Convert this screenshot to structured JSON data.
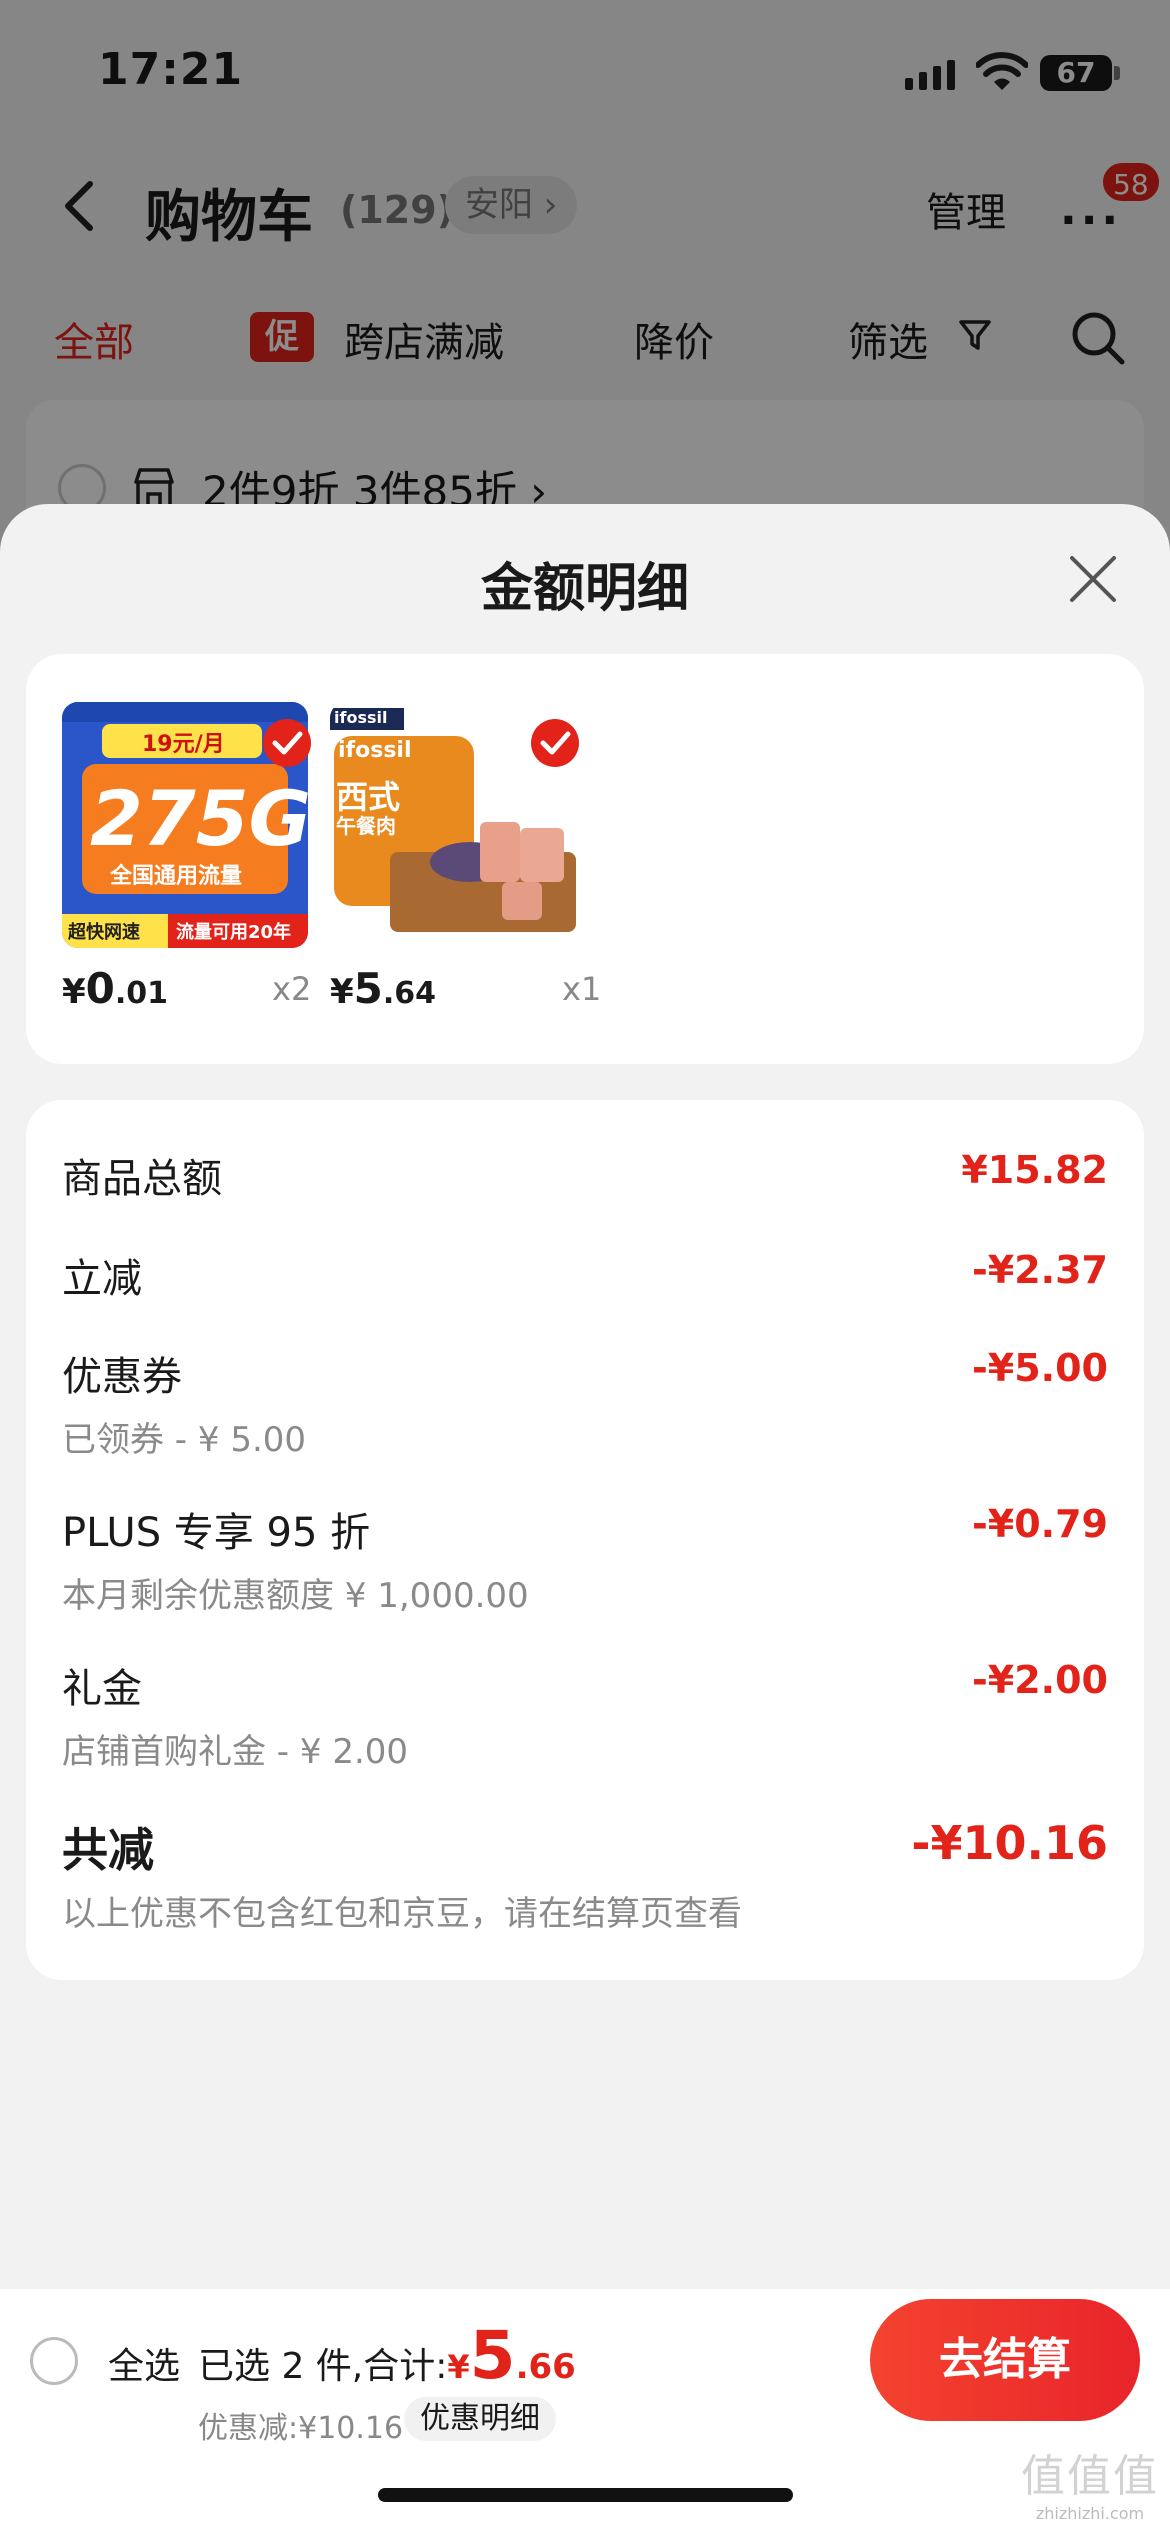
{
  "status_bar": {
    "time": "17:21",
    "battery": "67"
  },
  "nav": {
    "back_icon": "chevron-left-icon",
    "title": "购物车",
    "count": "(129)",
    "location": "安阳 ›",
    "manage": "管理",
    "more_icon": "more-dots-icon",
    "badge": "58"
  },
  "filters": {
    "all": "全部",
    "promo_tag": "促",
    "cross_store": "跨店满减",
    "price_drop": "降价",
    "screen": "筛选",
    "funnel_icon": "funnel-icon",
    "search_icon": "search-icon"
  },
  "store": {
    "promo": "2件9折 3件85折 ›"
  },
  "sheet": {
    "title": "金额明细",
    "close_icon": "close-icon",
    "products": [
      {
        "price_symbol": "¥",
        "price_int": "0",
        "price_dec": ".01",
        "qty": "x2",
        "img_text": {
          "top_band": "19元/月",
          "big": "275G",
          "sub": "全国通用流量",
          "left_tag": "超快网速",
          "right_tag": "流量可用20年"
        }
      },
      {
        "price_symbol": "¥",
        "price_int": "5",
        "price_dec": ".64",
        "qty": "x1",
        "img_text": {
          "brand": "ifossil",
          "label": "西式",
          "label2": "午餐肉"
        }
      }
    ],
    "rows": [
      {
        "label": "商品总额",
        "sub": "",
        "value": "¥15.82"
      },
      {
        "label": "立减",
        "sub": "",
        "value": "-¥2.37"
      },
      {
        "label": "优惠券",
        "sub": "已领券 - ¥ 5.00",
        "value": "-¥5.00"
      },
      {
        "label": "PLUS 专享 95 折",
        "sub": "本月剩余优惠额度 ¥ 1,000.00",
        "value": "-¥0.79"
      },
      {
        "label": "礼金",
        "sub": "店铺首购礼金 - ¥ 2.00",
        "value": "-¥2.00"
      }
    ],
    "total": {
      "label": "共减",
      "sub": "以上优惠不包含红包和京豆，请在结算页查看",
      "value": "-¥10.16"
    }
  },
  "bottom": {
    "select_all": "全选",
    "summary_prefix": "已选 2 件,合计:",
    "symbol": "¥",
    "total_int": "5",
    "total_dec": ".66",
    "discount": "优惠减:¥10.16",
    "detail_chip": "优惠明细",
    "checkout": "去结算"
  },
  "watermark": {
    "big": "值值值",
    "small": "zhizhizhi.com"
  },
  "colors": {
    "accent": "#e2231a",
    "checkout_start": "#f4432f",
    "checkout_end": "#e8242a"
  }
}
